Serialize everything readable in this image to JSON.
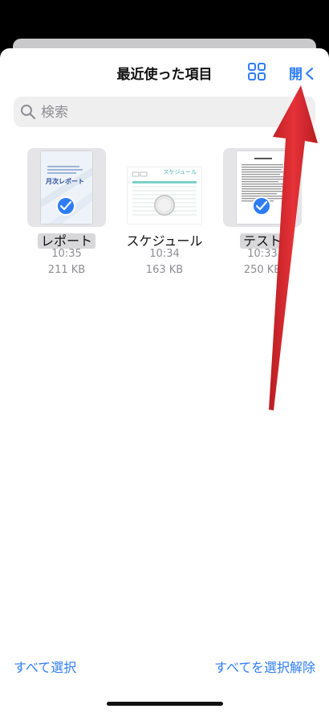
{
  "header": {
    "title": "最近使った項目",
    "open_label": "開く"
  },
  "search": {
    "placeholder": "検索",
    "value": ""
  },
  "files": [
    {
      "name": "レポート",
      "time": "10:35",
      "size": "211 KB",
      "selected": true,
      "thumb_title": "月次レポート"
    },
    {
      "name": "スケジュール",
      "time": "10:34",
      "size": "163 KB",
      "selected": false,
      "thumb_title": "スケジュール"
    },
    {
      "name": "テスト",
      "time": "10:33",
      "size": "250 KB",
      "selected": true,
      "thumb_title": ""
    }
  ],
  "footer": {
    "select_all": "すべて選択",
    "deselect_all": "すべてを選択解除"
  },
  "colors": {
    "accent": "#2f7df6",
    "arrow": "#d9252b"
  }
}
